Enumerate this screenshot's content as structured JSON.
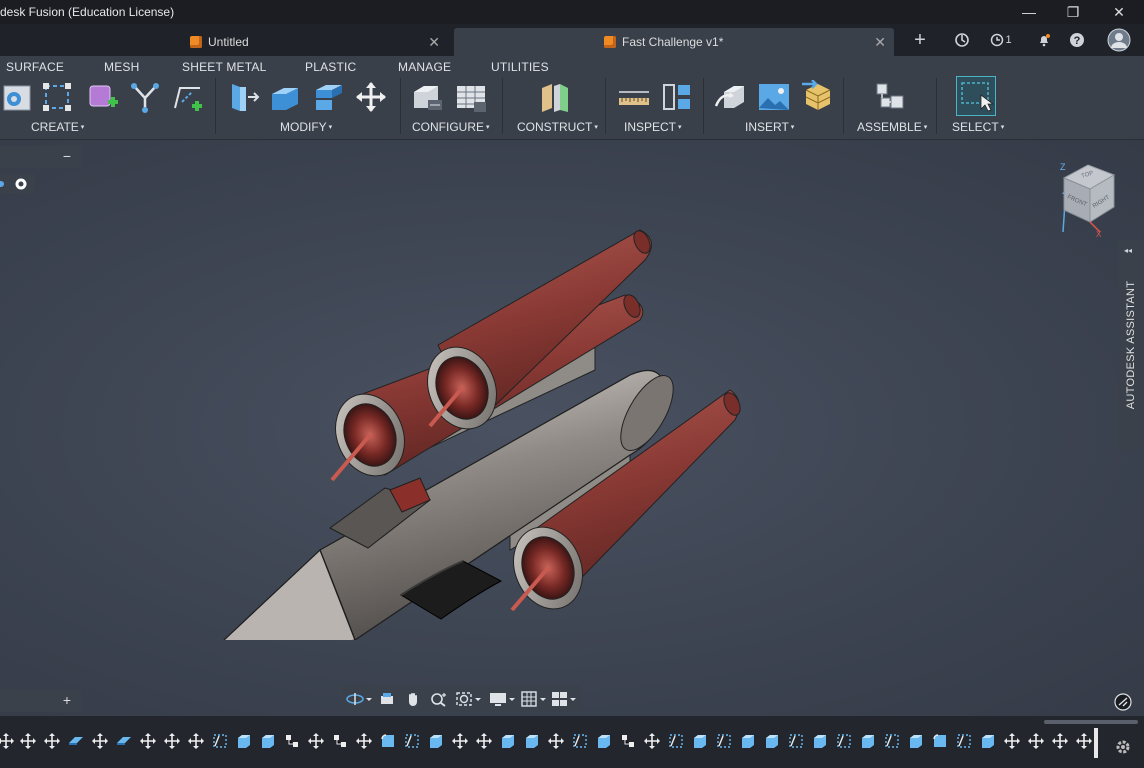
{
  "window": {
    "title": "desk Fusion (Education License)",
    "controls": [
      "—",
      "❐",
      "✕"
    ]
  },
  "tabs": [
    {
      "label": "Untitled",
      "close": "✕",
      "active": false
    },
    {
      "label": "Fast Challenge v1*",
      "close": "✕",
      "active": true
    }
  ],
  "tabbar": {
    "add": "+",
    "job_count": "1"
  },
  "ribbon": {
    "tabs": [
      "SURFACE",
      "MESH",
      "SHEET METAL",
      "PLASTIC",
      "MANAGE",
      "UTILITIES"
    ],
    "groups": {
      "create": "CREATE",
      "modify": "MODIFY",
      "configure": "CONFIGURE",
      "construct": "CONSTRUCT",
      "inspect": "INSPECT",
      "insert": "INSERT",
      "assemble": "ASSEMBLE",
      "select": "SELECT"
    },
    "caret": "▾"
  },
  "browser": {
    "collapse": "−"
  },
  "comments": {
    "add": "+"
  },
  "viewcube": {
    "top": "TOP",
    "front": "FRONT",
    "right": "RIGHT",
    "axis_z": "Z",
    "axis_x": "X"
  },
  "assistant": {
    "label": "AUTODESK ASSISTANT",
    "collapse": "◂◂"
  },
  "colors": {
    "accent": "#f08a24",
    "select_highlight": "#4fb3c8",
    "body_metal": "#9a9590",
    "engine_red": "#8b3a35"
  }
}
